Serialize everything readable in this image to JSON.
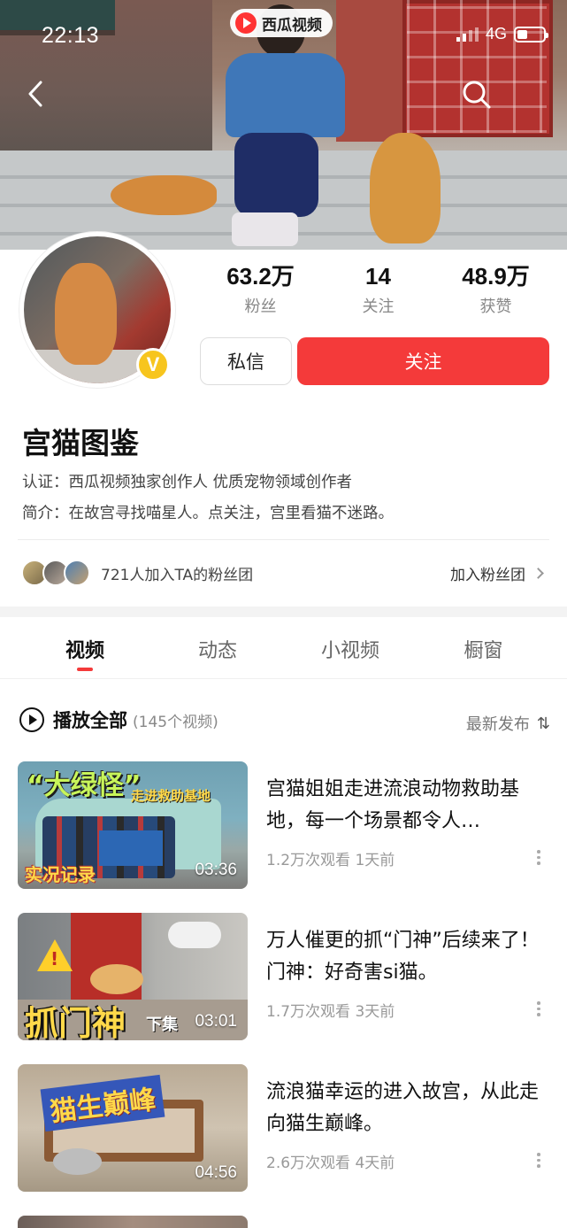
{
  "status_bar": {
    "time": "22:13",
    "network": "4G",
    "battery_level": 0.4
  },
  "header": {
    "app_badge": "西瓜视频",
    "back_icon": "back-arrow-icon",
    "search_icon": "search-icon"
  },
  "profile": {
    "name": "宫猫图鉴",
    "verified_badge": "V",
    "stats": [
      {
        "value": "63.2万",
        "label": "粉丝"
      },
      {
        "value": "14",
        "label": "关注"
      },
      {
        "value": "48.9万",
        "label": "获赞"
      }
    ],
    "message_button": "私信",
    "follow_button": "关注",
    "certification": "认证：西瓜视频独家创作人 优质宠物领域创作者",
    "intro": "简介：在故宫寻找喵星人。点关注，宫里看猫不迷路。"
  },
  "fan_club": {
    "text": "721人加入TA的粉丝团",
    "join_label": "加入粉丝团"
  },
  "tabs": [
    {
      "label": "视频",
      "active": true
    },
    {
      "label": "动态",
      "active": false
    },
    {
      "label": "小视频",
      "active": false
    },
    {
      "label": "橱窗",
      "active": false
    }
  ],
  "play_all": {
    "label": "播放全部",
    "count": "(145个视频)",
    "sort_label": "最新发布",
    "sort_icon": "⇅"
  },
  "videos": [
    {
      "thumb_title": "“大绿怪”",
      "thumb_sub": "走进救助基地",
      "thumb_tag": "实况记录",
      "duration": "03:36",
      "title": "宫猫姐姐走进流浪动物救助基地，每一个场景都令人…",
      "meta": "1.2万次观看 1天前"
    },
    {
      "thumb_title": "抓门神",
      "thumb_sub": "下集",
      "duration": "03:01",
      "title": "万人催更的抓“门神”后续来了！门神：好奇害si猫。",
      "meta": "1.7万次观看 3天前"
    },
    {
      "thumb_title": "猫生巅峰",
      "duration": "04:56",
      "title": "流浪猫幸运的进入故宫，从此走向猫生巅峰。",
      "meta": "2.6万次观看 4天前"
    }
  ],
  "colors": {
    "accent": "#f43a3a",
    "verified": "#f7c51e"
  }
}
